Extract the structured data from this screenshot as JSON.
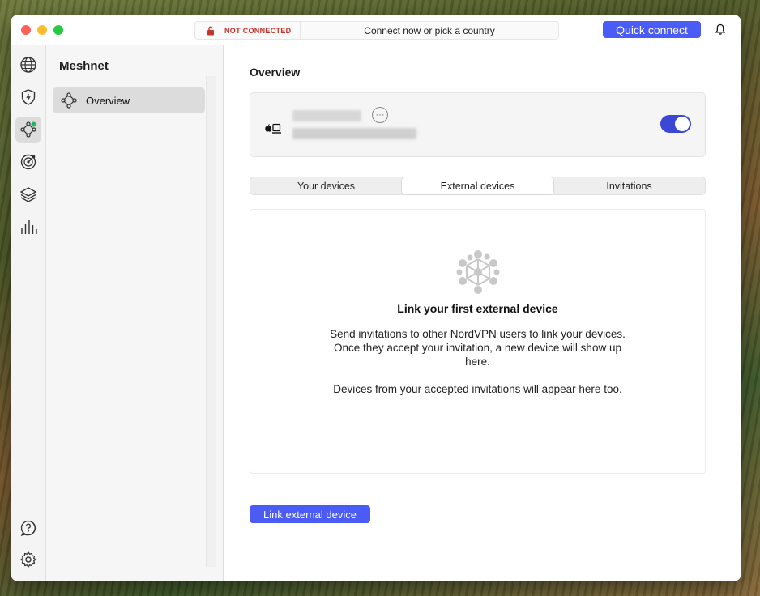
{
  "titlebar": {
    "status_text": "NOT CONNECTED",
    "connect_prompt": "Connect now or pick a country",
    "quick_connect_label": "Quick connect"
  },
  "iconbar": {
    "items": [
      {
        "icon": "globe-icon"
      },
      {
        "icon": "shield-bolt-icon"
      },
      {
        "icon": "meshnet-icon",
        "active": true
      },
      {
        "icon": "target-icon"
      },
      {
        "icon": "layers-icon"
      },
      {
        "icon": "stats-icon"
      }
    ],
    "bottom_items": [
      {
        "icon": "help-icon"
      },
      {
        "icon": "gear-icon"
      }
    ]
  },
  "sidebar": {
    "title": "Meshnet",
    "items": [
      {
        "label": "Overview",
        "icon": "meshnet-icon",
        "selected": true
      }
    ]
  },
  "main": {
    "title": "Overview",
    "device": {
      "toggle_on": true
    },
    "tabs": [
      {
        "label": "Your devices"
      },
      {
        "label": "External devices",
        "selected": true
      },
      {
        "label": "Invitations"
      }
    ],
    "empty_state": {
      "title": "Link your first external device",
      "description": "Send invitations to other NordVPN users to link your devices. Once they accept your invitation, a new device will show up here.",
      "note": "Devices from your accepted invitations will appear here too."
    },
    "link_button_label": "Link external device"
  },
  "colors": {
    "accent": "#4a5cf5",
    "toggle": "#3d47d6",
    "not_connected": "#c5332b"
  }
}
